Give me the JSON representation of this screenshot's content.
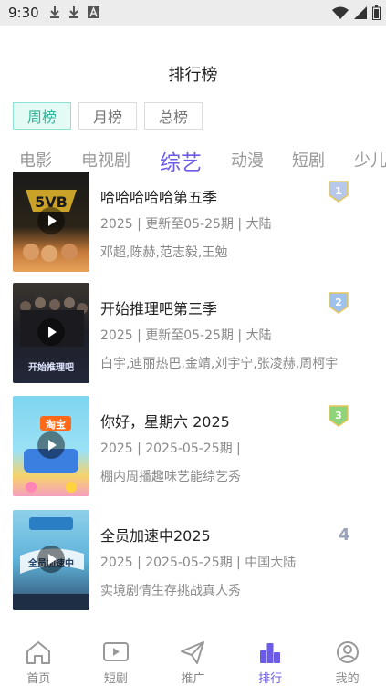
{
  "status_bar": {
    "time": "9:30",
    "icons": [
      "download-icon",
      "download-icon",
      "a-icon",
      "wifi-icon",
      "signal-icon",
      "battery-icon"
    ]
  },
  "page": {
    "title": "排行榜"
  },
  "period_tabs": [
    "周榜",
    "月榜",
    "总榜"
  ],
  "category_tabs": [
    "电影",
    "电视剧",
    "综艺",
    "动漫",
    "短剧",
    "少儿"
  ],
  "ranking": [
    {
      "rank": "1",
      "name": "哈哈哈哈哈第五季",
      "meta": "2025 | 更新至05-25期 | 大陆",
      "cast": "邓超,陈赫,范志毅,王勉",
      "poster_text": "5VB"
    },
    {
      "rank": "2",
      "name": "开始推理吧第三季",
      "meta": "2025 | 更新至05-25期 | 大陆",
      "cast": "白宇,迪丽热巴,金靖,刘宇宁,张凌赫,周柯宇",
      "poster_text": "开始推理吧"
    },
    {
      "rank": "3",
      "name": "你好，星期六 2025",
      "meta": "2025 | 2025-05-25期 |",
      "cast": "棚内周播趣味艺能综艺秀",
      "poster_text": "淘宝"
    },
    {
      "rank": "4",
      "name": "全员加速中2025",
      "meta": "2025 | 2025-05-25期 | 中国大陆",
      "cast": "实境剧情生存挑战真人秀",
      "poster_text": "全员加速中"
    }
  ],
  "bottom_nav": [
    {
      "label": "首页",
      "icon": "home-icon"
    },
    {
      "label": "短剧",
      "icon": "video-icon"
    },
    {
      "label": "推广",
      "icon": "send-icon"
    },
    {
      "label": "排行",
      "icon": "ranking-icon"
    },
    {
      "label": "我的",
      "icon": "profile-icon"
    }
  ],
  "colors": {
    "accent": "#6b5be7",
    "active_period_bg": "#e4faf5",
    "active_period_text": "#2fb79a"
  }
}
